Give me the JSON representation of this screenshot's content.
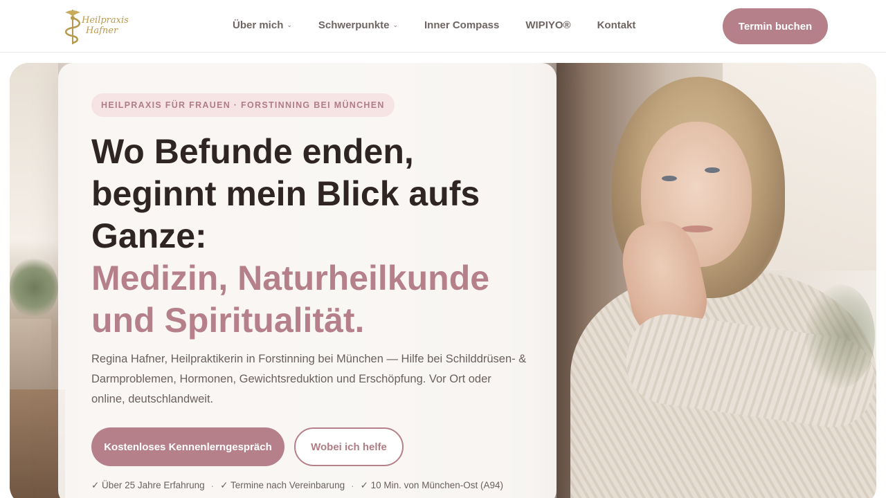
{
  "logo": {
    "line1": "Heilpraxis",
    "line2": "Hafner",
    "icon": "caduceus-logo-icon"
  },
  "nav": {
    "items": [
      {
        "label": "Über mich",
        "has_dropdown": true
      },
      {
        "label": "Schwerpunkte",
        "has_dropdown": true
      },
      {
        "label": "Inner Compass",
        "has_dropdown": false
      },
      {
        "label": "WIPIYO®",
        "has_dropdown": false
      },
      {
        "label": "Kontakt",
        "has_dropdown": false
      }
    ],
    "caret": "⌄",
    "cta_label": "Termin buchen"
  },
  "hero": {
    "eyebrow": "HEILPRAXIS FÜR FRAUEN · FORSTINNING BEI MÜNCHEN",
    "headline": {
      "line1": "Wo Befunde enden,",
      "line2": "beginnt mein Blick aufs",
      "line3": "Ganze:",
      "accent1": "Medizin, Naturheilkunde",
      "accent2": "und Spiritualität."
    },
    "lead": "Regina Hafner, Heilpraktikerin in Forstinning bei München — Hilfe bei Schilddrüsen- & Darmproblemen, Hormonen, Gewichtsreduktion und Erschöpfung. Vor Ort oder online, deutschlandweit.",
    "primary_button": "Kostenloses Kennenlerngespräch",
    "secondary_button": "Wobei ich helfe",
    "trust": [
      "✓ Über 25 Jahre Erfahrung",
      "✓ Termine nach Vereinbarung",
      "✓ 10 Min. von München-Ost (A94)"
    ],
    "trust_separator": "·"
  },
  "colors": {
    "accent": "#b5808a",
    "eyebrow_bg": "#f6e3e3",
    "logo_gold": "#b89a4e",
    "text_dark": "#2f2624",
    "text_muted": "#6a605e"
  }
}
